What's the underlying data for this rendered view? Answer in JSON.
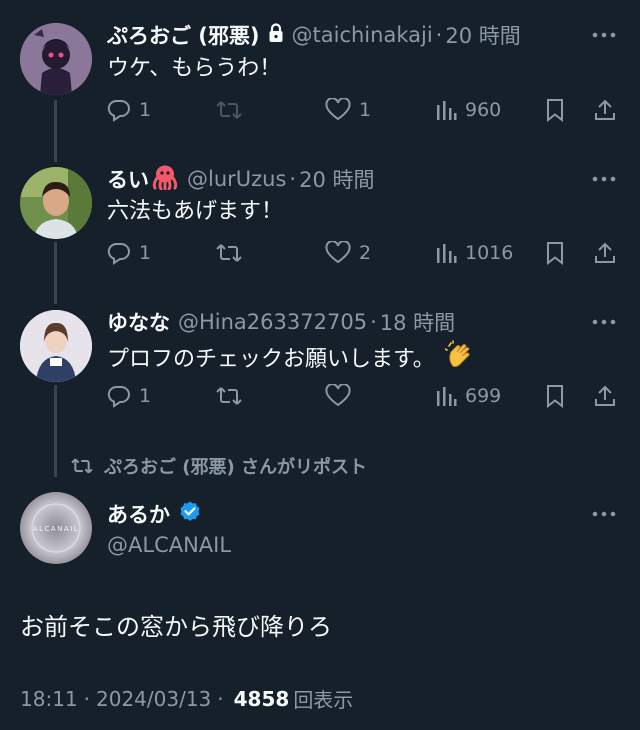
{
  "replies": [
    {
      "name": "ぷろおご (邪悪)",
      "handle": "@taichinakaji",
      "time": "20 時間",
      "text": "ウケ、もらうわ！",
      "reply_count": "1",
      "repost_count": "",
      "like_count": "1",
      "view_count": "960"
    },
    {
      "name": "るい",
      "handle": "@lurUzus",
      "time": "20 時間",
      "text": "六法もあげます！",
      "reply_count": "1",
      "repost_count": "",
      "like_count": "2",
      "view_count": "1016"
    },
    {
      "name": "ゆなな",
      "handle": "@Hina263372705",
      "time": "18 時間",
      "text": "プロフのチェックお願いします。",
      "reply_count": "1",
      "repost_count": "",
      "like_count": "",
      "view_count": "699"
    }
  ],
  "separator": "·",
  "repost_notice": "ぷろおご (邪悪) さんがリポスト",
  "main_tweet": {
    "avatar_text": "ALCANAIL",
    "name": "あるか",
    "handle": "@ALCANAIL",
    "text": "お前そこの窓から飛び降りろ",
    "time": "18:11",
    "date": "2024/03/13",
    "views": "4858",
    "views_label": "回表示"
  },
  "colors": {
    "background": "#15202b",
    "text": "#f7f9f9",
    "muted": "#8b98a5",
    "verified": "#1d9bf0",
    "thread_line": "#38444d"
  },
  "icons": [
    "lock-icon",
    "octopus-emoji",
    "clapping-hands-emoji",
    "reply-icon",
    "repost-icon",
    "like-icon",
    "views-icon",
    "bookmark-icon",
    "share-icon",
    "more-icon",
    "verified-badge-icon"
  ]
}
